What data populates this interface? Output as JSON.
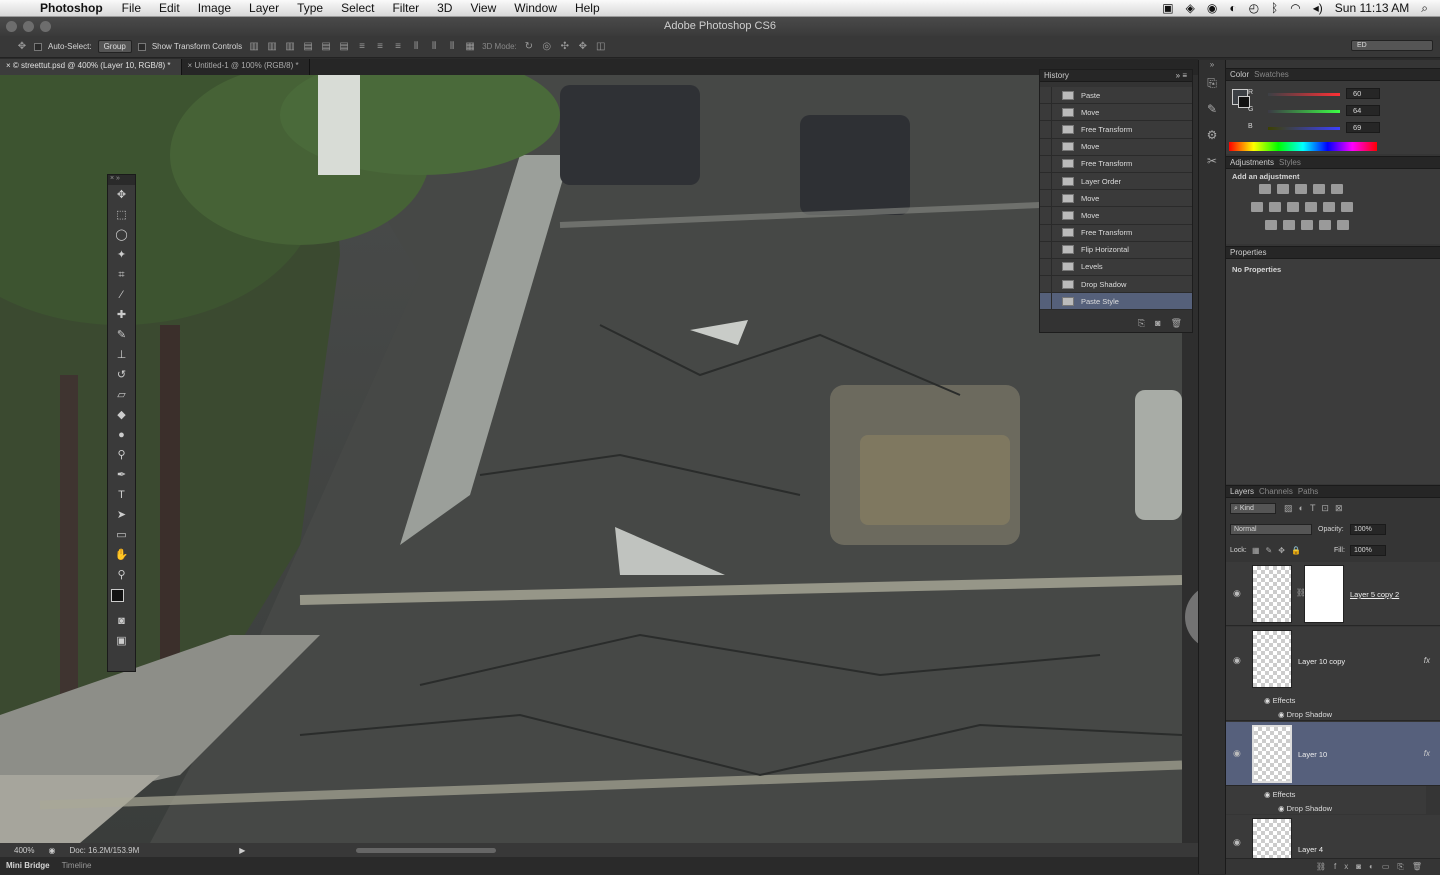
{
  "menubar": {
    "app": "Photoshop",
    "items": [
      "File",
      "Edit",
      "Image",
      "Layer",
      "Type",
      "Select",
      "Filter",
      "3D",
      "View",
      "Window",
      "Help"
    ],
    "clock": "Sun 11:13 AM"
  },
  "window": {
    "title": "Adobe Photoshop CS6"
  },
  "options": {
    "auto_select_label": "Auto-Select:",
    "auto_select_value": "Group",
    "show_transform_label": "Show Transform Controls",
    "mode_3d_label": "3D Mode:",
    "workspace": "ED"
  },
  "tabs": [
    {
      "label": "© streettut.psd @ 400% (Layer 10, RGB/8) *"
    },
    {
      "label": "Untitled-1 @ 100% (RGB/8) *"
    }
  ],
  "status": {
    "zoom": "400%",
    "doc": "Doc: 16.2M/153.9M"
  },
  "bottom_tabs": [
    "Mini Bridge",
    "Timeline"
  ],
  "history": {
    "title": "History",
    "items": [
      "Paste",
      "Move",
      "Free Transform",
      "Move",
      "Free Transform",
      "Layer Order",
      "Move",
      "Move",
      "Free Transform",
      "Flip Horizontal",
      "Levels",
      "Drop Shadow",
      "Paste Style"
    ],
    "current_index": 12
  },
  "color": {
    "tabs": [
      "Color",
      "Swatches"
    ],
    "r_label": "R",
    "g_label": "G",
    "b_label": "B",
    "r": "60",
    "g": "64",
    "b": "69",
    "fill_color": "#3c4045"
  },
  "adjustments": {
    "tabs": [
      "Adjustments",
      "Styles"
    ],
    "hint": "Add an adjustment"
  },
  "properties": {
    "title": "Properties",
    "text": "No Properties"
  },
  "layers": {
    "tabs": [
      "Layers",
      "Channels",
      "Paths"
    ],
    "kind": "Kind",
    "blend": "Normal",
    "opacity_label": "Opacity:",
    "opacity": "100%",
    "lock_label": "Lock:",
    "fill_label": "Fill:",
    "fill": "100%",
    "items": [
      {
        "name": "Layer 5 copy 2"
      },
      {
        "name": "Layer 10 copy",
        "fx": "fx",
        "effects": "Effects",
        "effect": "Drop Shadow"
      },
      {
        "name": "Layer 10",
        "fx": "fx",
        "effects": "Effects",
        "effect": "Drop Shadow"
      },
      {
        "name": "Layer 4"
      }
    ]
  }
}
